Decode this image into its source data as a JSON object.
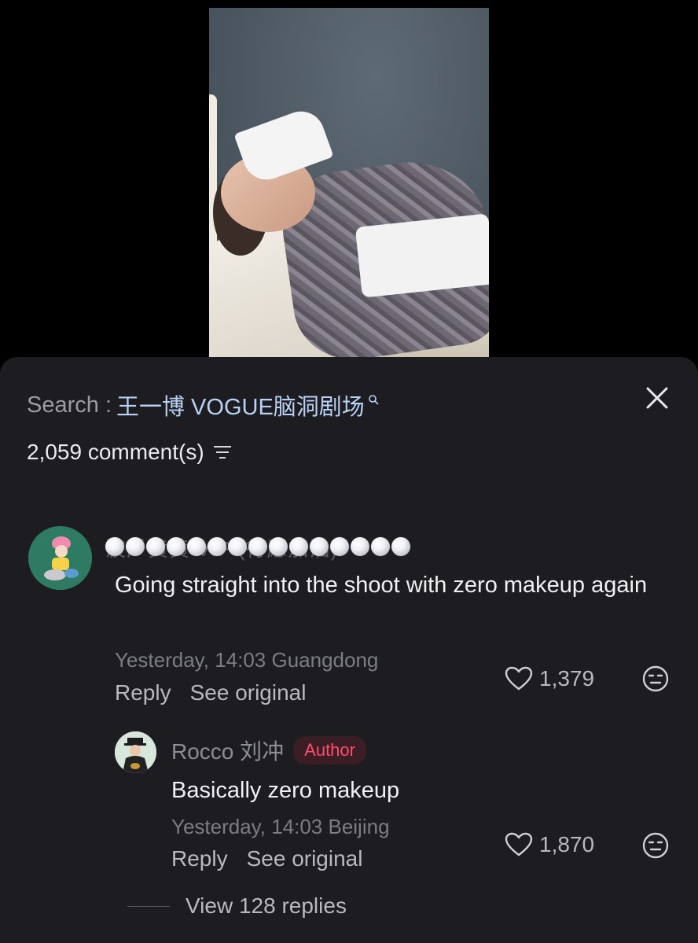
{
  "video": {
    "description_icon": "video-preview"
  },
  "search": {
    "prefix": "Search :",
    "term": "王一博 VOGUE脑洞剧场",
    "icon": "search-icon"
  },
  "close": {
    "icon": "close-icon"
  },
  "comments_header": {
    "count_label": "2,059 comment(s)",
    "filter_icon": "filter-icon"
  },
  "comment_1": {
    "username_obscured": "波⺁黄黄 VIP (行愿加油)",
    "text": "Going straight into the shoot with zero makeup again",
    "meta": "Yesterday, 14:03 Guangdong",
    "reply_label": "Reply",
    "see_original_label": "See original",
    "likes": "1,379"
  },
  "reply_1": {
    "username": "Rocco 刘冲",
    "badge": "Author",
    "text": "Basically zero makeup",
    "meta": "Yesterday, 14:03 Beijing",
    "reply_label": "Reply",
    "see_original_label": "See original",
    "likes": "1,870"
  },
  "view_replies_label": "View 128 replies",
  "colors": {
    "background": "#000000",
    "panel": "#1c1c21",
    "link_blue": "#b9d2f3",
    "author_red": "#ff4d6a",
    "muted": "#7c7c84"
  }
}
